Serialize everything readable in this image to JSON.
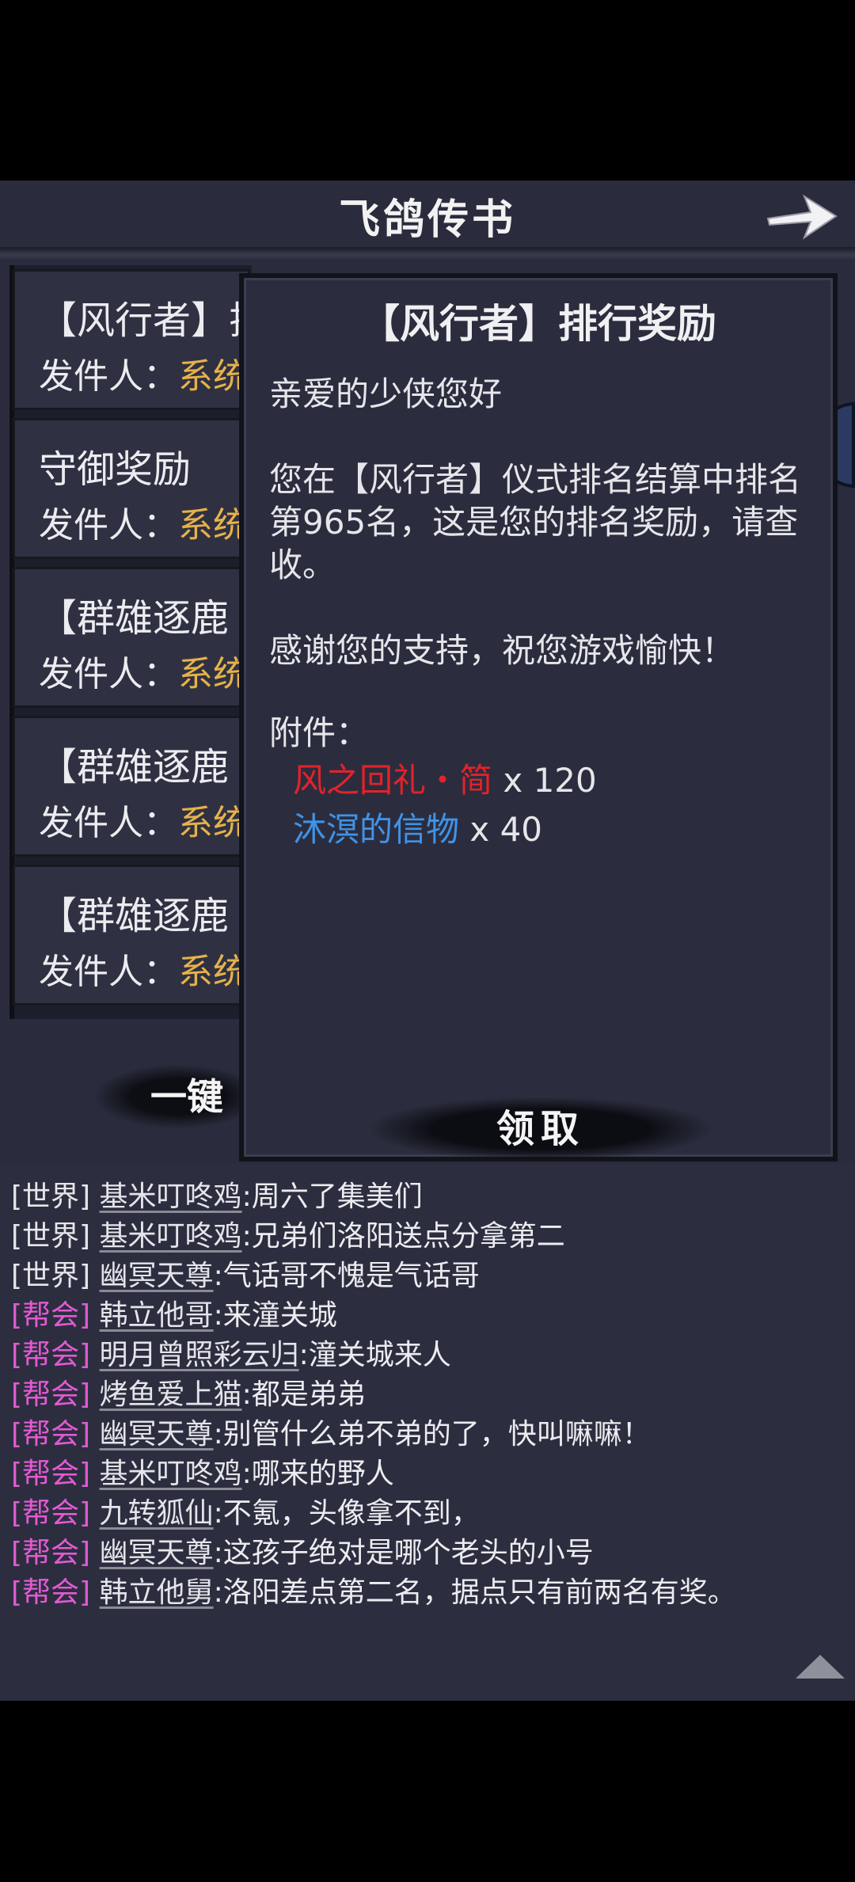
{
  "header": {
    "title": "飞鸽传书"
  },
  "icons": {
    "back": "arrow-right-icon",
    "scroll": "triangle-up-icon"
  },
  "mail_list": [
    {
      "title": "【风行者】排",
      "from_label": "发件人：",
      "from_value": "系统"
    },
    {
      "title": "守御奖励",
      "from_label": "发件人：",
      "from_value": "系统"
    },
    {
      "title": "【群雄逐鹿",
      "from_label": "发件人：",
      "from_value": "系统"
    },
    {
      "title": "【群雄逐鹿",
      "from_label": "发件人：",
      "from_value": "系统"
    },
    {
      "title": "【群雄逐鹿",
      "from_label": "发件人：",
      "from_value": "系统"
    }
  ],
  "claim_all_label": "一键",
  "detail": {
    "title": "【风行者】排行奖励",
    "greeting": "亲爱的少侠您好",
    "body": "您在【风行者】仪式排名结算中排名第965名，这是您的排名奖励，请查收。",
    "thanks": "感谢您的支持，祝您游戏愉快！",
    "attachments_label": "附件：",
    "attachments": [
      {
        "name": "风之回礼・简",
        "qty": "x 120",
        "color": "#e3222a"
      },
      {
        "name": "沐溟的信物",
        "qty": "x 40",
        "color": "#3f93e8"
      }
    ],
    "claim_label": "领取"
  },
  "chat": [
    {
      "channel": "[世界]",
      "type": "world",
      "name": "基米叮咚鸡",
      "msg": ":周六了集美们"
    },
    {
      "channel": "[世界]",
      "type": "world",
      "name": "基米叮咚鸡",
      "msg": ":兄弟们洛阳送点分拿第二"
    },
    {
      "channel": "[世界]",
      "type": "world",
      "name": "幽冥天尊",
      "msg": ":气话哥不愧是气话哥"
    },
    {
      "channel": "[帮会]",
      "type": "guild",
      "name": "韩立他哥",
      "msg": ":来潼关城"
    },
    {
      "channel": "[帮会]",
      "type": "guild",
      "name": "明月曾照彩云归",
      "msg": ":潼关城来人"
    },
    {
      "channel": "[帮会]",
      "type": "guild",
      "name": "烤鱼爱上猫",
      "msg": ":都是弟弟"
    },
    {
      "channel": "[帮会]",
      "type": "guild",
      "name": "幽冥天尊",
      "msg": ":别管什么弟不弟的了，快叫嘛嘛！"
    },
    {
      "channel": "[帮会]",
      "type": "guild",
      "name": "基米叮咚鸡",
      "msg": ":哪来的野人"
    },
    {
      "channel": "[帮会]",
      "type": "guild",
      "name": "九转狐仙",
      "msg": ":不氪，头像拿不到，"
    },
    {
      "channel": "[帮会]",
      "type": "guild",
      "name": "幽冥天尊",
      "msg": ":这孩子绝对是哪个老头的小号"
    },
    {
      "channel": "[帮会]",
      "type": "guild",
      "name": "韩立他舅",
      "msg": ":洛阳差点第二名，据点只有前两名有奖。"
    }
  ]
}
